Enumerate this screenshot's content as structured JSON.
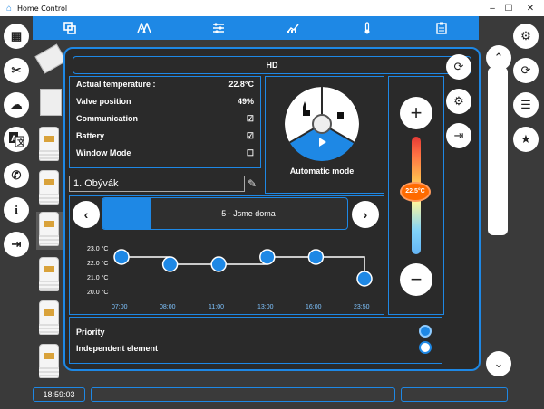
{
  "window": {
    "title": "Home Control",
    "controls": {
      "minimize": "–",
      "maximize": "☐",
      "close": "✕"
    }
  },
  "topbar": {
    "tabs": [
      {
        "icon": "devices-icon"
      },
      {
        "icon": "home-icon"
      },
      {
        "icon": "sliders-icon"
      },
      {
        "icon": "chart-icon"
      },
      {
        "icon": "thermometer-icon"
      },
      {
        "icon": "clipboard-icon"
      }
    ]
  },
  "left_nav": [
    {
      "icon": "calendar-icon"
    },
    {
      "icon": "tools-icon"
    },
    {
      "icon": "cloud-icon"
    },
    {
      "icon": "translate-icon"
    },
    {
      "icon": "phone-icon"
    },
    {
      "icon": "info-icon"
    },
    {
      "icon": "logout-icon"
    }
  ],
  "right_nav": [
    {
      "icon": "gear-icon"
    },
    {
      "icon": "refresh-icon"
    },
    {
      "icon": "sliders-icon"
    },
    {
      "icon": "star-icon"
    }
  ],
  "panel": {
    "title": "HD",
    "info": [
      {
        "label": "Actual temperature :",
        "value": "22.8°C"
      },
      {
        "label": "Valve position",
        "value": "49%"
      },
      {
        "label": "Communication",
        "value": "☑"
      },
      {
        "label": "Battery",
        "value": "☑"
      },
      {
        "label": "Window Mode",
        "value": "☐"
      }
    ],
    "room_name": "1. Obývák",
    "mode_label": "Automatic mode",
    "profile": {
      "label": "5 - Jsme doma",
      "progress": 0.2
    },
    "schedule": {
      "y_ticks": [
        "23.0 °C",
        "22.0 °C",
        "21.0 °C",
        "20.0 °C"
      ],
      "x_labels": [
        "07:00",
        "08:00",
        "11:00",
        "13:00",
        "16:00",
        "23:50"
      ],
      "temps": [
        22.5,
        22.0,
        22.0,
        22.5,
        22.5,
        21.0
      ]
    },
    "setpoint": "22.5°C",
    "flags": [
      {
        "label": "Priority",
        "selected": true
      },
      {
        "label": "Independent element",
        "selected": false
      }
    ]
  },
  "side_buttons": [
    {
      "icon": "refresh-icon"
    },
    {
      "icon": "settings-search-icon"
    },
    {
      "icon": "export-icon"
    }
  ],
  "status": {
    "time": "18:59:03"
  }
}
